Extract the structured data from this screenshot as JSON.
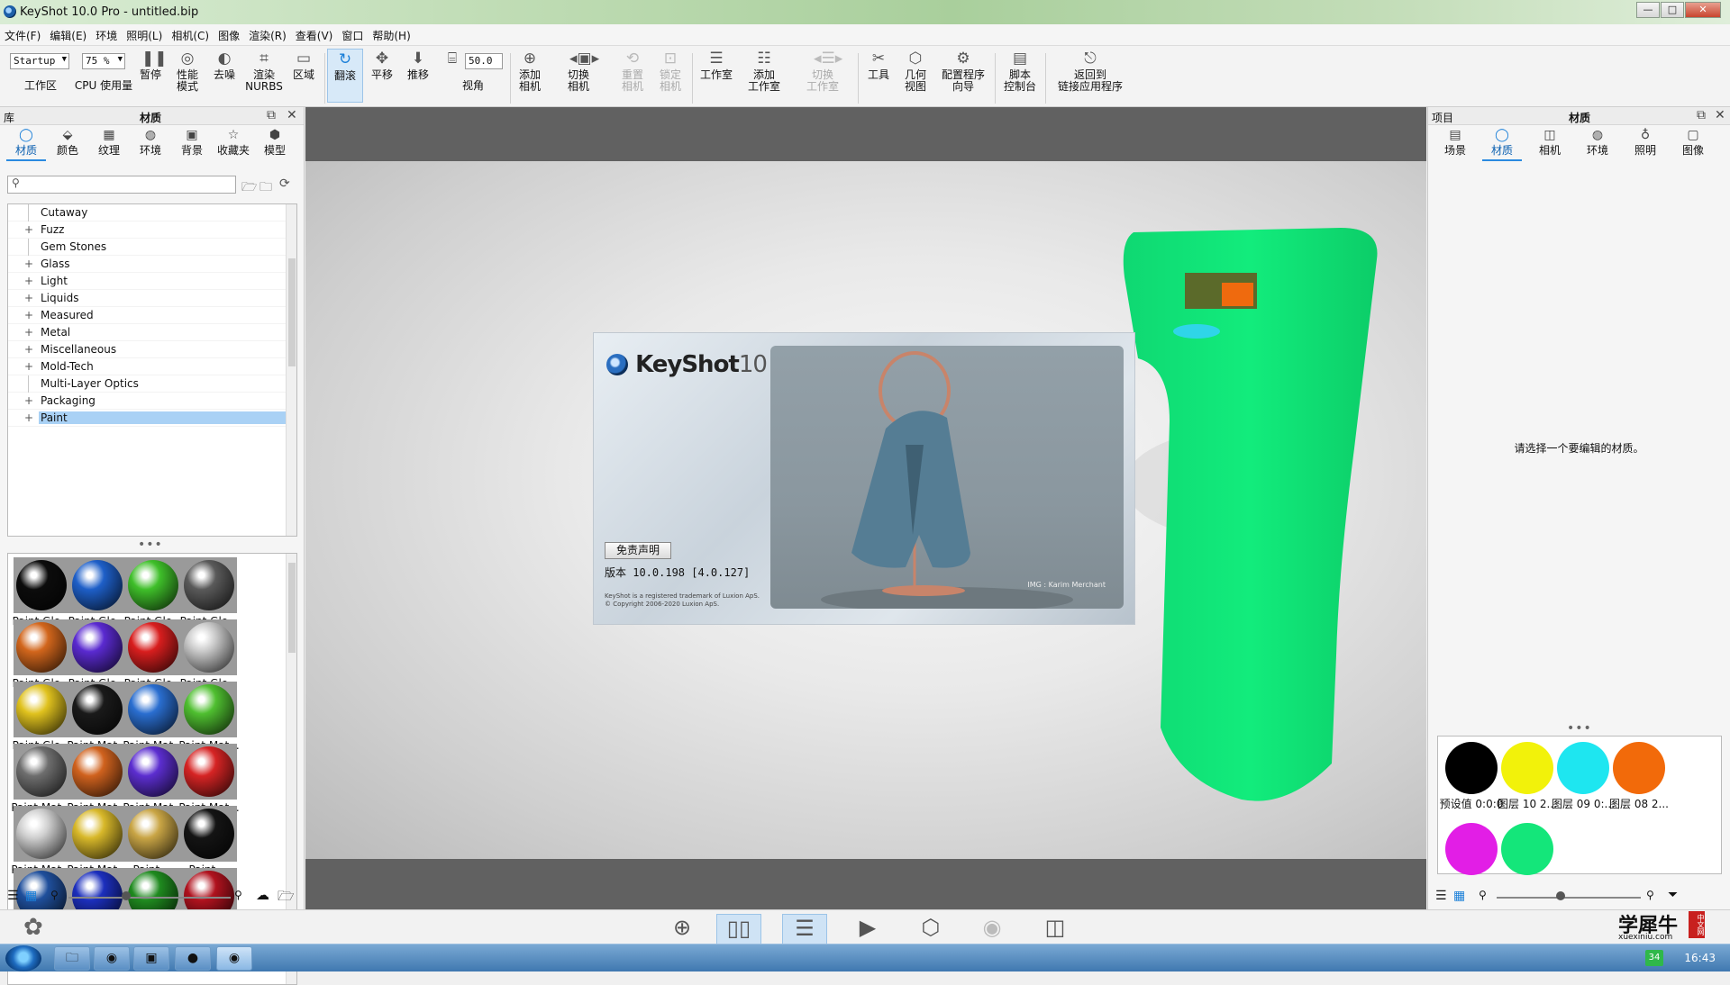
{
  "window": {
    "title": "KeyShot 10.0 Pro  - untitled.bip",
    "controls": [
      "—",
      "□",
      "✕"
    ]
  },
  "menu": [
    "文件(F)",
    "编辑(E)",
    "环境",
    "照明(L)",
    "相机(C)",
    "图像",
    "渲染(R)",
    "查看(V)",
    "窗口",
    "帮助(H)"
  ],
  "toolbar": {
    "workspace_value": "Startup",
    "workspace_label": "工作区",
    "cpu_value": "75 %",
    "cpu_label": "CPU 使用量",
    "pause": "暂停",
    "performance": "性能\n模式",
    "denoise": "去噪",
    "render_nurbs": "渲染\nNURBS",
    "region": "区域",
    "tumble": "翻滚",
    "pan": "平移",
    "dolly": "推移",
    "fov_value": "50.0",
    "fov_label": "视角",
    "add_camera": "添加\n相机",
    "switch_camera": "切换\n相机",
    "reset_camera": "重置\n相机",
    "lock_camera": "锁定\n相机",
    "studio": "工作室",
    "add_studio": "添加\n工作室",
    "switch_studio": "切换\n工作室",
    "tools": "工具",
    "geometry_view": "几何\n视图",
    "config_wizard": "配置程序\n向导",
    "script_console": "脚本\n控制台",
    "return_linked": "返回到\n链接应用程序"
  },
  "library": {
    "header_left": "库",
    "header_center": "材质",
    "tabs": [
      "材质",
      "颜色",
      "纹理",
      "环境",
      "背景",
      "收藏夹",
      "模型"
    ],
    "search_placeholder": "",
    "tree": [
      {
        "label": "Cutaway",
        "expandable": false
      },
      {
        "label": "Fuzz",
        "expandable": true
      },
      {
        "label": "Gem Stones",
        "expandable": false
      },
      {
        "label": "Glass",
        "expandable": true
      },
      {
        "label": "Light",
        "expandable": true
      },
      {
        "label": "Liquids",
        "expandable": true
      },
      {
        "label": "Measured",
        "expandable": true
      },
      {
        "label": "Metal",
        "expandable": true
      },
      {
        "label": "Miscellaneous",
        "expandable": true
      },
      {
        "label": "Mold-Tech",
        "expandable": true
      },
      {
        "label": "Multi-Layer Optics",
        "expandable": false
      },
      {
        "label": "Packaging",
        "expandable": true
      },
      {
        "label": "Paint",
        "expandable": true,
        "selected": true
      }
    ],
    "materials": [
      {
        "label": "Paint Glo...",
        "color": "#0c0c0c"
      },
      {
        "label": "Paint Glo...",
        "color": "#1e5fc8"
      },
      {
        "label": "Paint Glo...",
        "color": "#3fbf2a"
      },
      {
        "label": "Paint Glo...",
        "color": "#5a5a5a"
      },
      {
        "label": "Paint Glo...",
        "color": "#d2661c"
      },
      {
        "label": "Paint Glo...",
        "color": "#5a2ad0"
      },
      {
        "label": "Paint Glo...",
        "color": "#d81e1e"
      },
      {
        "label": "Paint Glo...",
        "color": "#c8c8c8"
      },
      {
        "label": "Paint Glo...",
        "color": "#e0c21e"
      },
      {
        "label": "Paint Mat...",
        "color": "#1a1a1a"
      },
      {
        "label": "Paint Mat...",
        "color": "#2a6ed0"
      },
      {
        "label": "Paint Mat...",
        "color": "#4fbf30"
      },
      {
        "label": "Paint Mat...",
        "color": "#6e6e6e"
      },
      {
        "label": "Paint Mat...",
        "color": "#d0621e"
      },
      {
        "label": "Paint Mat...",
        "color": "#5c2ed0"
      },
      {
        "label": "Paint Mat...",
        "color": "#d62424"
      },
      {
        "label": "Paint Mat...",
        "color": "#cfcfcf"
      },
      {
        "label": "Paint Mat...",
        "color": "#d8b82a"
      },
      {
        "label": "Paint ...",
        "color": "#c9a545"
      },
      {
        "label": "Paint ...",
        "color": "#141414"
      },
      {
        "label": "",
        "color": "#1f4f9c"
      },
      {
        "label": "",
        "color": "#1c2fbd"
      },
      {
        "label": "",
        "color": "#1f8a1f"
      },
      {
        "label": "",
        "color": "#b0121e"
      }
    ]
  },
  "viewport": {
    "splash": {
      "logo": "KeyShot",
      "logo_version": "10",
      "disclaimer_button": "免责声明",
      "version": "版本 10.0.198 [4.0.127]",
      "legal_1": "KeyShot is a registered trademark of Luxion ApS.",
      "legal_2": "© Copyright 2006-2020 Luxion ApS.",
      "image_credit": "IMG : Karim Merchant"
    }
  },
  "project": {
    "header_left": "项目",
    "header_center": "材质",
    "tabs": [
      "场景",
      "材质",
      "相机",
      "环境",
      "照明",
      "图像"
    ],
    "empty_message": "请选择一个要编辑的材质。",
    "materials": [
      {
        "label": "预设值 0:0:0",
        "color": "#000000"
      },
      {
        "label": "图层 10 2...",
        "color": "#f2f20a"
      },
      {
        "label": "图层 09 0:...",
        "color": "#1ee6f0"
      },
      {
        "label": "图层 08 2...",
        "color": "#f26a0a"
      },
      {
        "label": "",
        "color": "#e21ee6"
      },
      {
        "label": "",
        "color": "#14e67a"
      }
    ]
  },
  "watermark": {
    "name": "学犀牛",
    "url": "xuexiniu.com",
    "badge": "中文网"
  },
  "taskbar": {
    "clock": "16:43",
    "badge": "34"
  }
}
